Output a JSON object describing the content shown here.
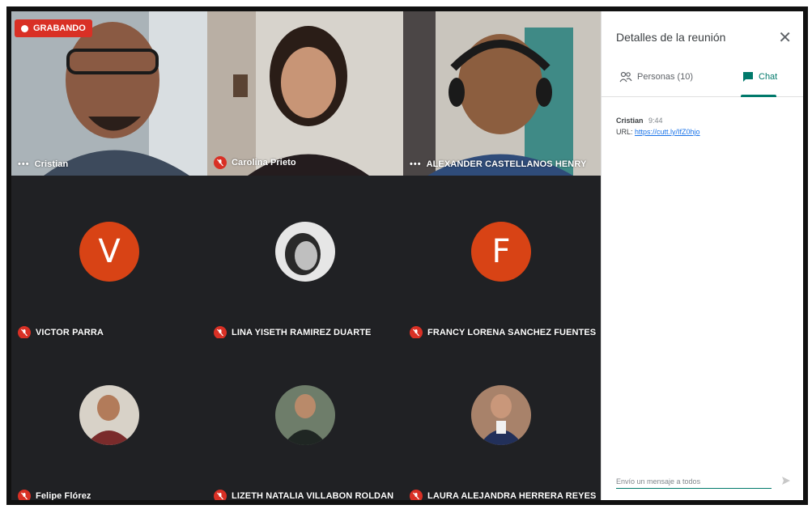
{
  "recording": {
    "label": "GRABANDO"
  },
  "video_tiles": [
    {
      "name": "Cristian",
      "indicator": "dots"
    },
    {
      "name": "Carolina Prieto",
      "indicator": "mic-off"
    },
    {
      "name": "ALEXANDER CASTELLANOS HENRY",
      "indicator": "dots"
    }
  ],
  "avatar_tiles": [
    {
      "name": "VICTOR PARRA",
      "initial": "V",
      "color": "#d84315"
    },
    {
      "name": "LINA YISETH RAMIREZ DUARTE",
      "initial": "",
      "color": "#444444"
    },
    {
      "name": "FRANCY LORENA SANCHEZ FUENTES",
      "initial": "F",
      "color": "#d84315"
    },
    {
      "name": "Felipe Flórez",
      "initial": "",
      "color": "#5a4a40"
    },
    {
      "name": "LIZETH NATALIA VILLABON ROLDAN",
      "initial": "",
      "color": "#2f3a35"
    },
    {
      "name": "LAURA ALEJANDRA HERRERA REYES",
      "initial": "",
      "color": "#6a4a3a"
    }
  ],
  "panel": {
    "title": "Detalles de la reunión",
    "tabs": [
      {
        "label": "Personas (10)",
        "icon": "people-icon"
      },
      {
        "label": "Chat",
        "icon": "chat-icon",
        "active": true
      }
    ],
    "messages": [
      {
        "author": "Cristian",
        "time": "9:44",
        "prefix": "URL:",
        "link": "https://cutt.ly/IfZ0hjo"
      }
    ],
    "input_placeholder": "Envío un mensaje a todos"
  },
  "colors": {
    "accent": "#00796b",
    "recording": "#d93025",
    "avatar_orange": "#d84315",
    "grid_bg": "#202124"
  }
}
